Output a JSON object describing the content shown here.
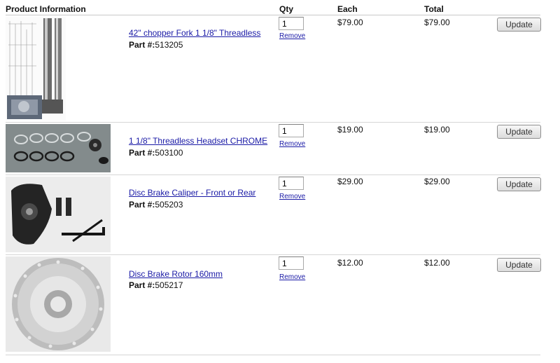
{
  "headers": {
    "product": "Product Information",
    "qty": "Qty",
    "each": "Each",
    "total": "Total"
  },
  "rows": [
    {
      "name": "42\" chopper Fork 1 1/8\" Threadless",
      "part_label": "Part #:",
      "part_no": "513205",
      "qty": "1",
      "remove": "Remove",
      "each": "$79.00",
      "total": "$79.00",
      "update": "Update"
    },
    {
      "name": "1 1/8\" Threadless Headset CHROME",
      "part_label": "Part #:",
      "part_no": "503100",
      "qty": "1",
      "remove": "Remove",
      "each": "$19.00",
      "total": "$19.00",
      "update": "Update"
    },
    {
      "name": "Disc Brake Caliper - Front or Rear",
      "part_label": "Part #:",
      "part_no": "505203",
      "qty": "1",
      "remove": "Remove",
      "each": "$29.00",
      "total": "$29.00",
      "update": "Update"
    },
    {
      "name": "Disc Brake Rotor 160mm",
      "part_label": "Part #:",
      "part_no": "505217",
      "qty": "1",
      "remove": "Remove",
      "each": "$12.00",
      "total": "$12.00",
      "update": "Update"
    }
  ]
}
